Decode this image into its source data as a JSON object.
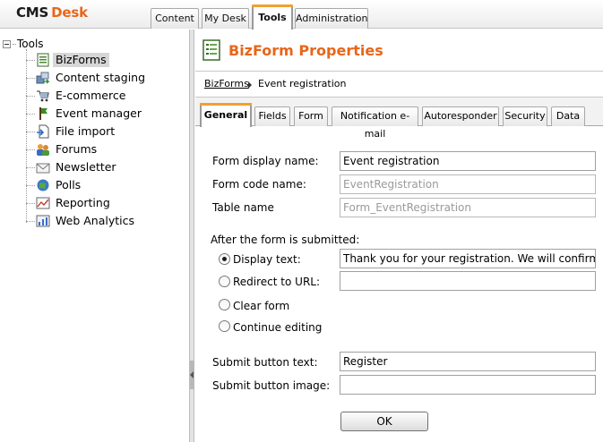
{
  "app": {
    "logo_cms": "CMS",
    "logo_desk": "Desk",
    "accent": "#e8661a"
  },
  "top_tabs": [
    {
      "label": "Content"
    },
    {
      "label": "My Desk"
    },
    {
      "label": "Tools",
      "active": true
    },
    {
      "label": "Administration"
    }
  ],
  "tree": {
    "root": "Tools",
    "items": [
      {
        "label": "BizForms",
        "icon": "bizform-icon",
        "selected": true
      },
      {
        "label": "Content staging",
        "icon": "staging-icon"
      },
      {
        "label": "E-commerce",
        "icon": "ecommerce-icon"
      },
      {
        "label": "Event manager",
        "icon": "event-icon"
      },
      {
        "label": "File import",
        "icon": "file-import-icon"
      },
      {
        "label": "Forums",
        "icon": "forums-icon"
      },
      {
        "label": "Newsletter",
        "icon": "newsletter-icon"
      },
      {
        "label": "Polls",
        "icon": "polls-icon"
      },
      {
        "label": "Reporting",
        "icon": "reporting-icon"
      },
      {
        "label": "Web Analytics",
        "icon": "analytics-icon"
      }
    ]
  },
  "panel": {
    "title": "BizForm Properties",
    "breadcrumb": {
      "link": "BizForms",
      "current": "Event registration"
    },
    "tabs": [
      {
        "label": "General",
        "active": true
      },
      {
        "label": "Fields"
      },
      {
        "label": "Form"
      },
      {
        "label": "Notification e-mail"
      },
      {
        "label": "Autoresponder"
      },
      {
        "label": "Security"
      },
      {
        "label": "Data"
      }
    ]
  },
  "form": {
    "display_name_label": "Form display name:",
    "display_name_value": "Event registration",
    "code_name_label": "Form code name:",
    "code_name_value": "EventRegistration",
    "table_name_label": "Table name",
    "table_name_value": "Form_EventRegistration",
    "after_submit_label": "After the form is submitted:",
    "options": [
      {
        "label": "Display text:",
        "checked": true
      },
      {
        "label": "Redirect to URL:",
        "checked": false
      },
      {
        "label": "Clear form",
        "checked": false
      },
      {
        "label": "Continue editing",
        "checked": false
      }
    ],
    "display_text_value": "Thank you for your registration. We will confirm it",
    "redirect_url_value": "",
    "submit_text_label": "Submit button text:",
    "submit_text_value": "Register",
    "submit_image_label": "Submit button image:",
    "submit_image_value": "",
    "ok_label": "OK"
  }
}
